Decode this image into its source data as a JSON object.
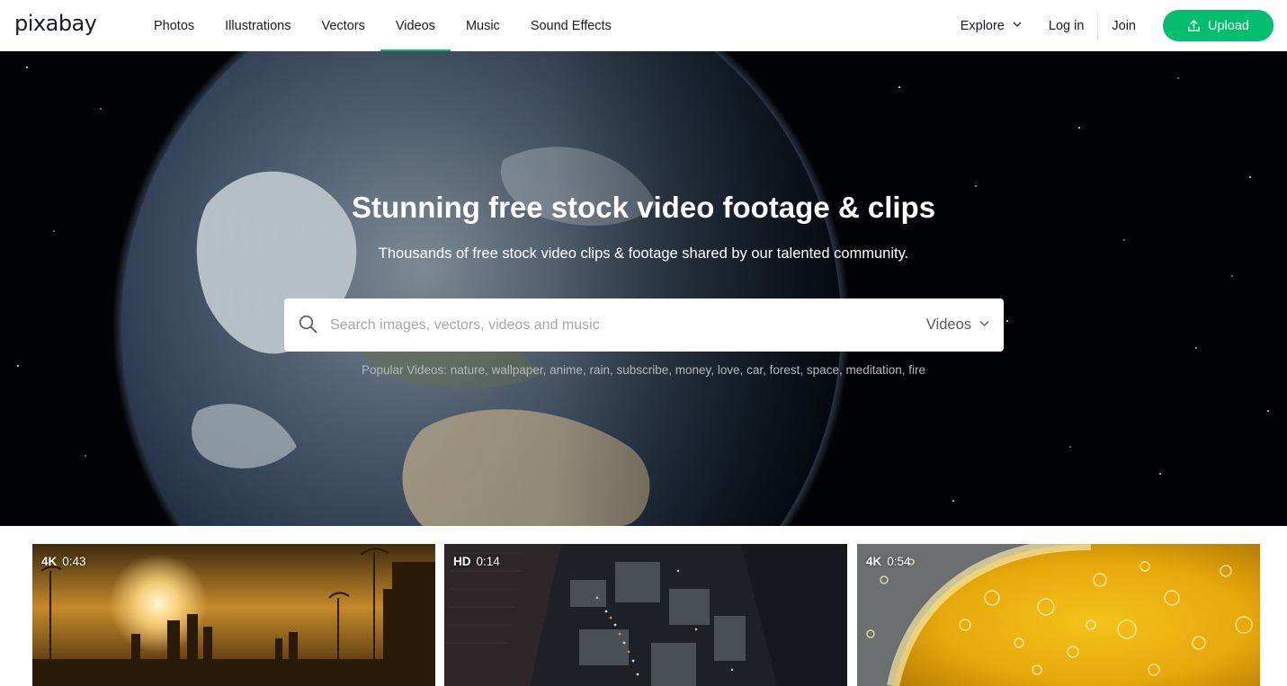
{
  "brand": {
    "logo_text": "pixabay",
    "accent": "#02be6e"
  },
  "nav": {
    "items": [
      {
        "label": "Photos",
        "active": false
      },
      {
        "label": "Illustrations",
        "active": false
      },
      {
        "label": "Vectors",
        "active": false
      },
      {
        "label": "Videos",
        "active": true
      },
      {
        "label": "Music",
        "active": false
      },
      {
        "label": "Sound Effects",
        "active": false
      }
    ],
    "explore_label": "Explore",
    "login_label": "Log in",
    "join_label": "Join",
    "upload_label": "Upload"
  },
  "hero": {
    "title": "Stunning free stock video footage & clips",
    "subtitle": "Thousands of free stock video clips & footage shared by our talented community."
  },
  "search": {
    "placeholder": "Search images, vectors, videos and music",
    "value": "",
    "type_label": "Videos"
  },
  "popular": {
    "prefix": "Popular Videos:",
    "tags": [
      "nature",
      "wallpaper",
      "anime",
      "rain",
      "subscribe",
      "money",
      "love",
      "car",
      "forest",
      "space",
      "meditation",
      "fire"
    ]
  },
  "thumbnails": [
    {
      "quality": "4K",
      "duration": "0:43"
    },
    {
      "quality": "HD",
      "duration": "0:14"
    },
    {
      "quality": "4K",
      "duration": "0:54"
    }
  ],
  "icons": {
    "search": "search-icon",
    "chevron": "chevron-down-icon",
    "upload": "upload-icon"
  }
}
